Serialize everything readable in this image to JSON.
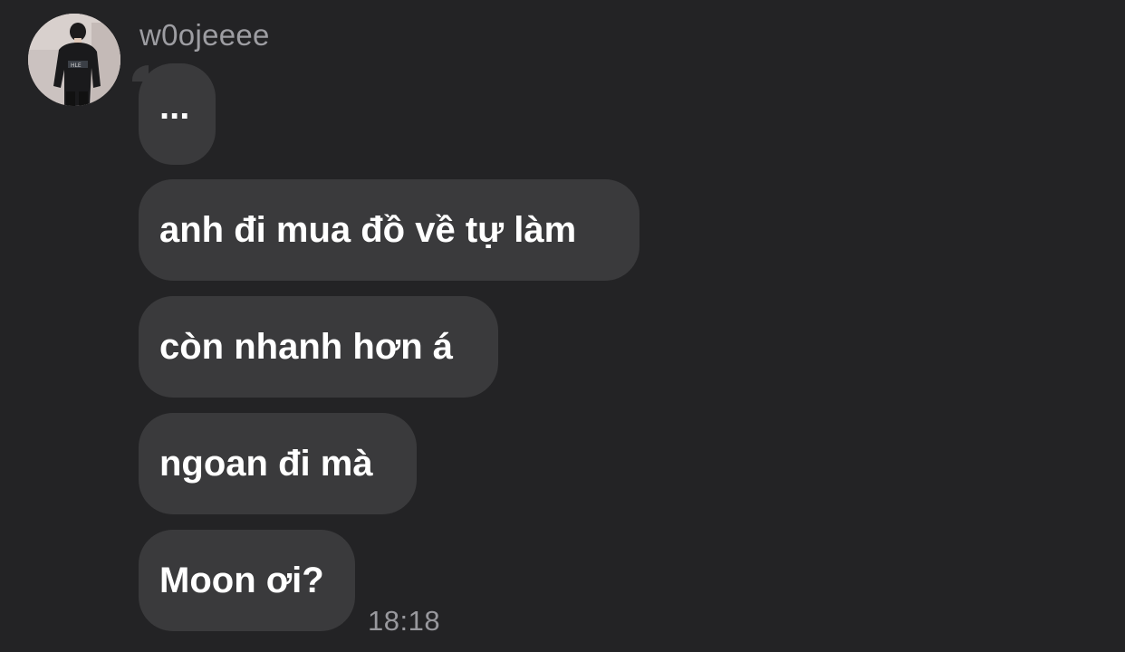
{
  "chat": {
    "sender_name": "w0ojeeee",
    "messages": [
      {
        "text": "..."
      },
      {
        "text": "anh đi mua đồ về tự làm"
      },
      {
        "text": "còn nhanh hơn á"
      },
      {
        "text": "ngoan đi mà"
      },
      {
        "text": "Moon ơi?"
      }
    ],
    "timestamp": "18:18"
  },
  "colors": {
    "background": "#232325",
    "bubble": "#3a3a3c",
    "sender_name": "#9d9da2",
    "timestamp": "#98989d",
    "message_text": "#ffffff"
  }
}
